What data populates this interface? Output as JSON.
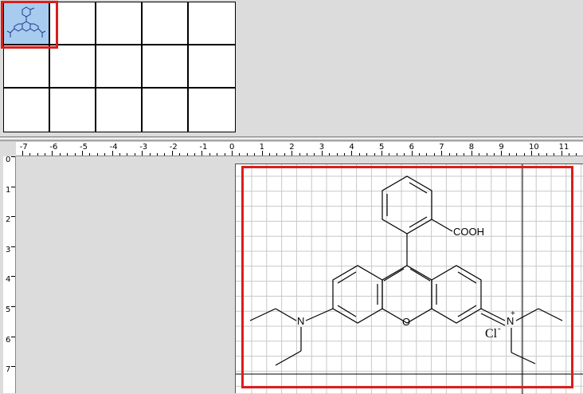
{
  "rulers": {
    "horizontal": [
      "-7",
      "-6",
      "-5",
      "-4",
      "-3",
      "-2",
      "-1",
      "0",
      "1",
      "2",
      "3",
      "4",
      "5",
      "6",
      "7",
      "8",
      "9",
      "10",
      "11"
    ],
    "vertical": [
      "0",
      "1",
      "2",
      "3",
      "4",
      "5",
      "6",
      "7"
    ]
  },
  "molecule": {
    "group_label": "COOH",
    "charge_label": "+",
    "nitrogen_left": "N",
    "nitrogen_right": "N",
    "oxygen": "O",
    "counter_ion": "Cl",
    "counter_charge": "-"
  },
  "colors": {
    "selection": "#d91e1e",
    "thumb_selected": "#a8ccf0",
    "grid": "#c8c8c8"
  }
}
